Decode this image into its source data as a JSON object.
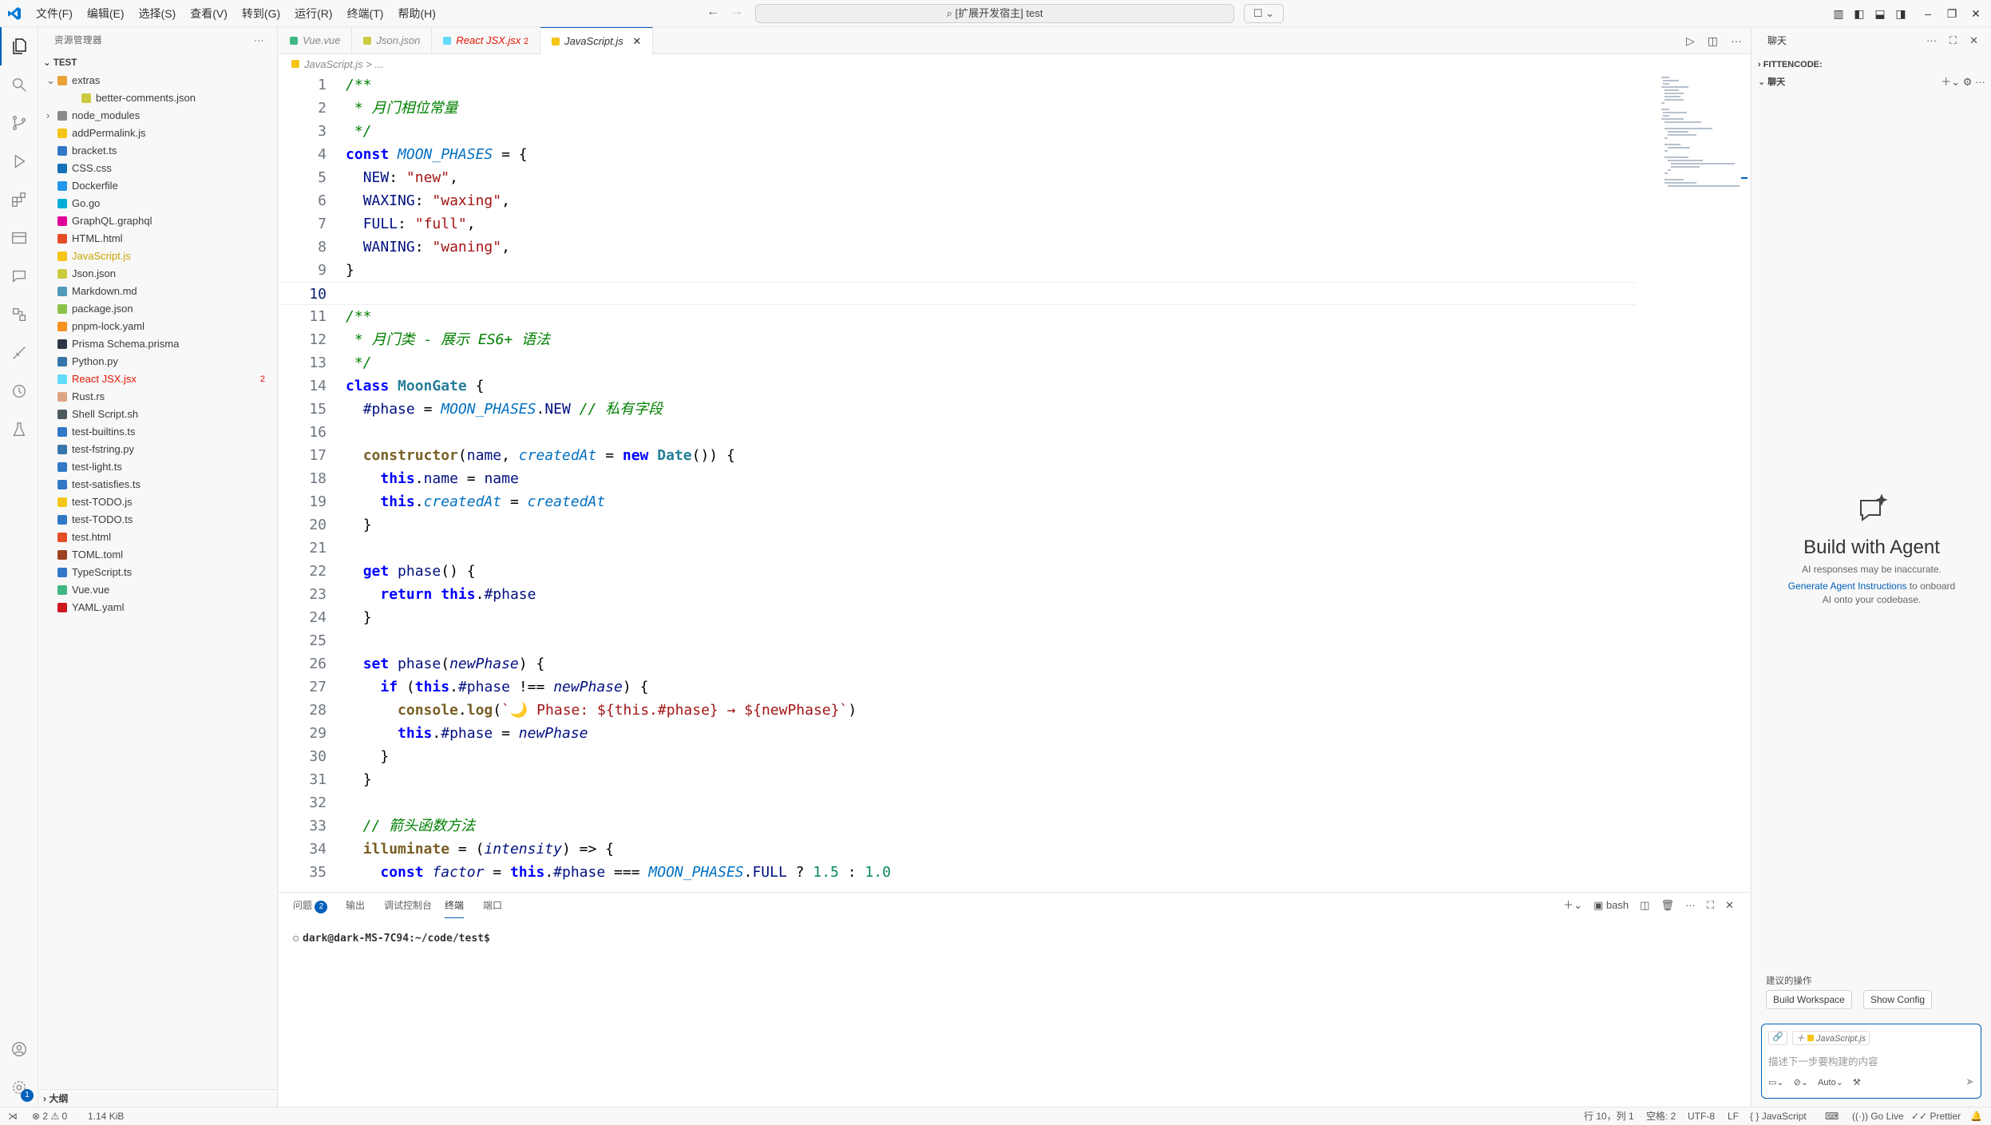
{
  "menu": [
    "文件(F)",
    "编辑(E)",
    "选择(S)",
    "查看(V)",
    "转到(G)",
    "运行(R)",
    "终端(T)",
    "帮助(H)"
  ],
  "command_center": "[扩展开发宿主] test",
  "sidebar": {
    "header": "资源管理器",
    "root": "TEST",
    "items": [
      {
        "label": "extras",
        "color": "#e8a23a",
        "kind": "folder"
      },
      {
        "label": "better-comments.json",
        "color": "#cbcb41",
        "kind": "file"
      },
      {
        "label": "node_modules",
        "color": "#8a8a8a",
        "kind": "folder"
      },
      {
        "label": "addPermalink.js",
        "color": "#f5c518",
        "kind": "file"
      },
      {
        "label": "bracket.ts",
        "color": "#3178c6",
        "kind": "file"
      },
      {
        "label": "CSS.css",
        "color": "#1572b6",
        "kind": "file"
      },
      {
        "label": "Dockerfile",
        "color": "#2496ed",
        "kind": "file"
      },
      {
        "label": "Go.go",
        "color": "#00add8",
        "kind": "file"
      },
      {
        "label": "GraphQL.graphql",
        "color": "#e10098",
        "kind": "file"
      },
      {
        "label": "HTML.html",
        "color": "#e44d26",
        "kind": "file"
      },
      {
        "label": "JavaScript.js",
        "color": "#f5c518",
        "kind": "file"
      },
      {
        "label": "Json.json",
        "color": "#cbcb41",
        "kind": "file"
      },
      {
        "label": "Markdown.md",
        "color": "#519aba",
        "kind": "file"
      },
      {
        "label": "package.json",
        "color": "#8bc34a",
        "kind": "file"
      },
      {
        "label": "pnpm-lock.yaml",
        "color": "#f69220",
        "kind": "file"
      },
      {
        "label": "Prisma Schema.prisma",
        "color": "#2d3748",
        "kind": "file"
      },
      {
        "label": "Python.py",
        "color": "#3776ab",
        "kind": "file"
      },
      {
        "label": "React JSX.jsx",
        "color": "#61dafb",
        "kind": "file"
      },
      {
        "label": "Rust.rs",
        "color": "#dea584",
        "kind": "file"
      },
      {
        "label": "Shell Script.sh",
        "color": "#4d5a5e",
        "kind": "file"
      },
      {
        "label": "test-builtins.ts",
        "color": "#3178c6",
        "kind": "file"
      },
      {
        "label": "test-fstring.py",
        "color": "#3776ab",
        "kind": "file"
      },
      {
        "label": "test-light.ts",
        "color": "#3178c6",
        "kind": "file"
      },
      {
        "label": "test-satisfies.ts",
        "color": "#3178c6",
        "kind": "file"
      },
      {
        "label": "test-TODO.js",
        "color": "#f5c518",
        "kind": "file"
      },
      {
        "label": "test-TODO.ts",
        "color": "#3178c6",
        "kind": "file"
      },
      {
        "label": "test.html",
        "color": "#e44d26",
        "kind": "file"
      },
      {
        "label": "TOML.toml",
        "color": "#9c4221",
        "kind": "file"
      },
      {
        "label": "TypeScript.ts",
        "color": "#3178c6",
        "kind": "file"
      },
      {
        "label": "Vue.vue",
        "color": "#41b883",
        "kind": "file"
      },
      {
        "label": "YAML.yaml",
        "color": "#cb171e",
        "kind": "file"
      }
    ],
    "react_badge": "2",
    "outline": "大纲"
  },
  "tabs": [
    {
      "label": "Vue.vue",
      "color": "#41b883"
    },
    {
      "label": "Json.json",
      "color": "#cbcb41"
    },
    {
      "label": "React JSX.jsx",
      "color": "#61dafb",
      "badge": "2"
    },
    {
      "label": "JavaScript.js",
      "color": "#f5c518"
    }
  ],
  "breadcrumb": "JavaScript.js > ...",
  "code_lines": [
    "/**",
    " * 月门相位常量",
    " */",
    "const MOON_PHASES = {",
    "  NEW: \"new\",",
    "  WAXING: \"waxing\",",
    "  FULL: \"full\",",
    "  WANING: \"waning\",",
    "}",
    "",
    "/**",
    " * 月门类 - 展示 ES6+ 语法",
    " */",
    "class MoonGate {",
    "  #phase = MOON_PHASES.NEW // 私有字段",
    "",
    "  constructor(name, createdAt = new Date()) {",
    "    this.name = name",
    "    this.createdAt = createdAt",
    "  }",
    "",
    "  get phase() {",
    "    return this.#phase",
    "  }",
    "",
    "  set phase(newPhase) {",
    "    if (this.#phase !== newPhase) {",
    "      console.log(`🌙 Phase: ${this.#phase} → ${newPhase}`)",
    "      this.#phase = newPhase",
    "    }",
    "  }",
    "",
    "  // 箭头函数方法",
    "  illuminate = (intensity) => {",
    "    const factor = this.#phase === MOON_PHASES.FULL ? 1.5 : 1.0"
  ],
  "current_line": 10,
  "panel": {
    "tabs": [
      "问题",
      "输出",
      "调试控制台",
      "终端",
      "端口"
    ],
    "problems_badge": "2",
    "shell": "bash",
    "prompt": "dark@dark-MS-7C94:~/code/test$"
  },
  "chat": {
    "title": "聊天",
    "section1": "FITTENCODE:",
    "section2": "聊天",
    "heading": "Build with Agent",
    "sub": "AI responses may be inaccurate.",
    "link": "Generate Agent Instructions",
    "link_tail": " to onboard AI onto your codebase.",
    "suggest_label": "建议的操作",
    "btn1": "Build Workspace",
    "btn2": "Show Config",
    "context_file": "JavaScript.js",
    "placeholder": "描述下一步要构建的内容",
    "mode": "Auto"
  },
  "status": {
    "errors": "2",
    "warnings": "0",
    "size": "1.14 KiB",
    "position": "行 10，列 1",
    "spaces": "空格: 2",
    "encoding": "UTF-8",
    "eol": "LF",
    "language": "JavaScript",
    "golive": "Go Live",
    "prettier": "Prettier"
  },
  "settings_badge": "1"
}
